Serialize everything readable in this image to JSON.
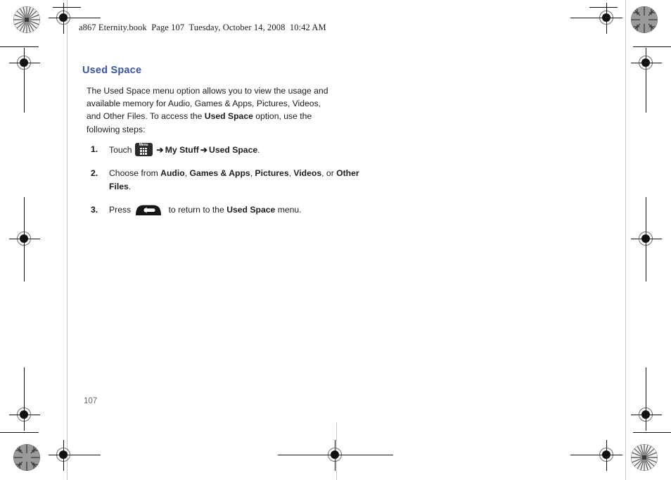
{
  "document": {
    "header_line": "a867 Eternity.book  Page 107  Tuesday, October 14, 2008  10:42 AM",
    "page_number": "107",
    "title": "Used Space",
    "title_color": "#3b55a8",
    "intro": {
      "part1": "The Used Space menu option allows you to view the usage and available memory for Audio, Games & Apps, Pictures, Videos, and Other Files. To access the ",
      "bold": "Used Space",
      "part2": " option, use the following steps:"
    },
    "steps": [
      {
        "number": "1.",
        "lead": "Touch",
        "icon": "menu-key-icon",
        "icon_label": "Menu",
        "arrow": "➔",
        "target1": "My Stuff",
        "target2": "Used Space",
        "trailing": "."
      },
      {
        "number": "2.",
        "lead": "Choose from ",
        "options": [
          "Audio",
          "Games & Apps",
          "Pictures",
          "Videos",
          "Other Files"
        ],
        "separator": ", ",
        "conjunction": ", or ",
        "trailing": "."
      },
      {
        "number": "3.",
        "lead": "Press",
        "icon": "back-key-icon",
        "mid": " to return to the ",
        "bold": "Used Space",
        "trailing": " menu."
      }
    ]
  },
  "print_marks": {
    "registration_label": "registration-target",
    "starburst_label": "resolution-starburst-target"
  }
}
